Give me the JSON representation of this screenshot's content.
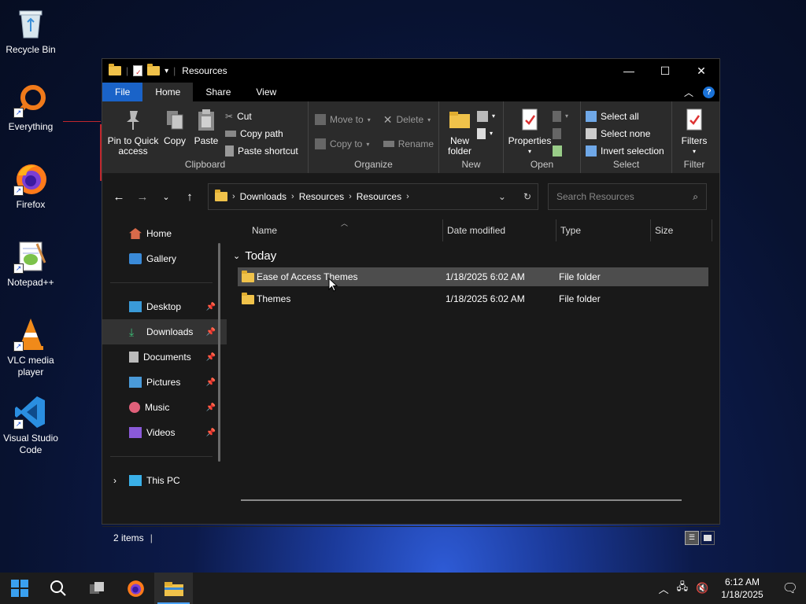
{
  "desktop": {
    "icons": [
      {
        "label": "Recycle Bin"
      },
      {
        "label": "Everything"
      },
      {
        "label": "Firefox"
      },
      {
        "label": "Notepad++"
      },
      {
        "label": "VLC media player"
      },
      {
        "label": "Visual Studio Code"
      }
    ]
  },
  "window": {
    "title": "Resources",
    "controls": {
      "minimize": "—",
      "maximize": "☐",
      "close": "✕"
    }
  },
  "ribbon_tabs": {
    "file": "File",
    "home": "Home",
    "share": "Share",
    "view": "View"
  },
  "ribbon": {
    "clipboard": {
      "label": "Clipboard",
      "pin": "Pin to Quick access",
      "copy": "Copy",
      "paste": "Paste",
      "cut": "Cut",
      "copy_path": "Copy path",
      "paste_shortcut": "Paste shortcut"
    },
    "organize": {
      "label": "Organize",
      "move_to": "Move to",
      "copy_to": "Copy to",
      "delete": "Delete",
      "rename": "Rename"
    },
    "new": {
      "label": "New",
      "new_folder": "New folder"
    },
    "open": {
      "label": "Open",
      "properties": "Properties"
    },
    "select": {
      "label": "Select",
      "select_all": "Select all",
      "select_none": "Select none",
      "invert": "Invert selection"
    },
    "filter": {
      "label": "Filter",
      "filters": "Filters"
    }
  },
  "address": {
    "crumbs": [
      "Downloads",
      "Resources",
      "Resources"
    ],
    "search_placeholder": "Search Resources"
  },
  "nav": {
    "top": [
      {
        "label": "Home"
      },
      {
        "label": "Gallery"
      }
    ],
    "pinned": [
      {
        "label": "Desktop"
      },
      {
        "label": "Downloads"
      },
      {
        "label": "Documents"
      },
      {
        "label": "Pictures"
      },
      {
        "label": "Music"
      },
      {
        "label": "Videos"
      }
    ],
    "this_pc": "This PC"
  },
  "columns": {
    "name": "Name",
    "date": "Date modified",
    "type": "Type",
    "size": "Size"
  },
  "group_header": "Today",
  "files": [
    {
      "name": "Ease of Access Themes",
      "date": "1/18/2025 6:02 AM",
      "type": "File folder"
    },
    {
      "name": "Themes",
      "date": "1/18/2025 6:02 AM",
      "type": "File folder"
    }
  ],
  "status": {
    "items": "2 items"
  },
  "taskbar": {
    "time": "6:12 AM",
    "date": "1/18/2025"
  },
  "colors": {
    "accent": "#1a63c8",
    "folder": "#f0c24a",
    "selection": "#4d4d4d"
  }
}
